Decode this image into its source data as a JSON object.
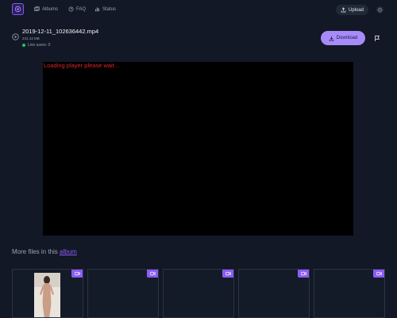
{
  "header": {
    "nav": [
      {
        "label": "Albums",
        "icon": "albums-icon"
      },
      {
        "label": "FAQ",
        "icon": "help-circle-icon"
      },
      {
        "label": "Status",
        "icon": "bar-chart-icon"
      }
    ],
    "upload_label": "Upload"
  },
  "file": {
    "name": "2019-12-11_102636442.mp4",
    "size": "241.13 MB",
    "live_users": "Live users: 0",
    "download_label": "Download"
  },
  "player": {
    "message": "Loading player please wait..."
  },
  "more_files": {
    "prefix": "More files in this ",
    "link": "album"
  },
  "thumbnails": [
    {
      "type": "video",
      "has_preview": true
    },
    {
      "type": "video",
      "has_preview": false
    },
    {
      "type": "video",
      "has_preview": false
    },
    {
      "type": "video",
      "has_preview": false
    },
    {
      "type": "video",
      "has_preview": false
    }
  ],
  "colors": {
    "background": "#121826",
    "accent": "#a78bfa",
    "badge": "#8b5cf6",
    "live": "#22c55e",
    "player_message": "#dc2626"
  }
}
